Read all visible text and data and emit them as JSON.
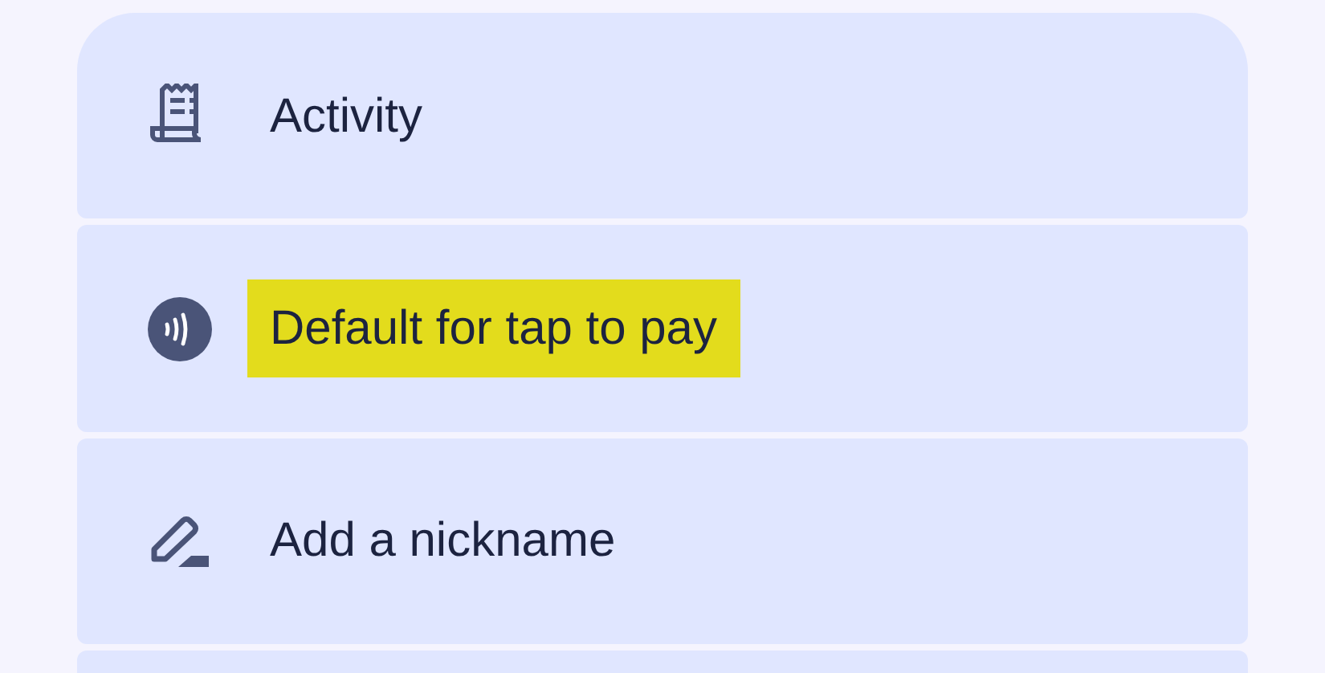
{
  "items": [
    {
      "kind": "row",
      "label": "Activity",
      "highlighted": false
    },
    {
      "kind": "row",
      "label": "Default for tap to pay",
      "highlighted": true
    },
    {
      "kind": "row",
      "label": "Add a nickname",
      "highlighted": false
    },
    {
      "kind": "blank"
    }
  ]
}
